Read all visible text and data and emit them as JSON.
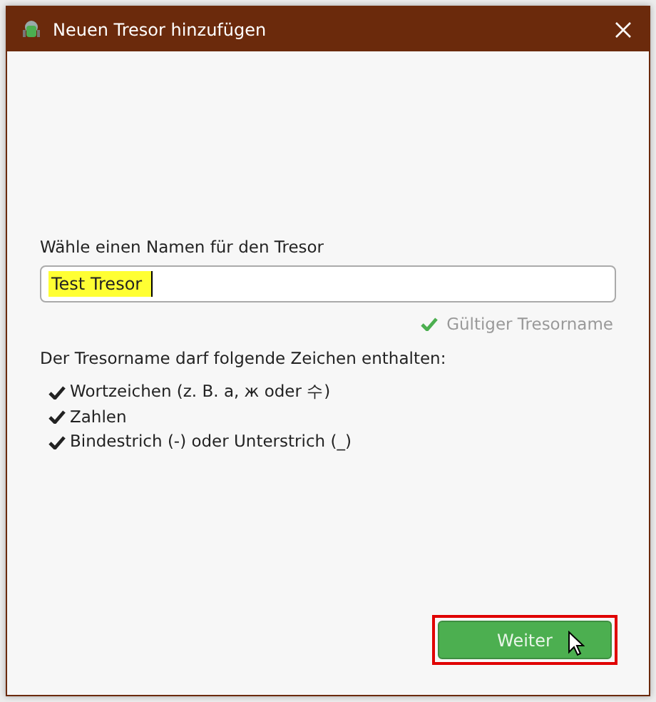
{
  "window": {
    "title": "Neuen Tresor hinzufügen"
  },
  "name_field": {
    "label": "Wähle einen Namen für den Tresor",
    "value": "Test Tresor",
    "value_highlighted": true
  },
  "validation": {
    "text": "Gültiger Tresorname",
    "valid": true
  },
  "rules": {
    "heading": "Der Tresorname darf folgende Zeichen enthalten:",
    "items": [
      {
        "text": "Wortzeichen (z. B. a, ж oder 수)"
      },
      {
        "text": "Zahlen"
      },
      {
        "text": "Bindestrich (-) oder Unterstrich (_)"
      }
    ]
  },
  "next_button": {
    "label": "Weiter",
    "highlighted": true
  }
}
